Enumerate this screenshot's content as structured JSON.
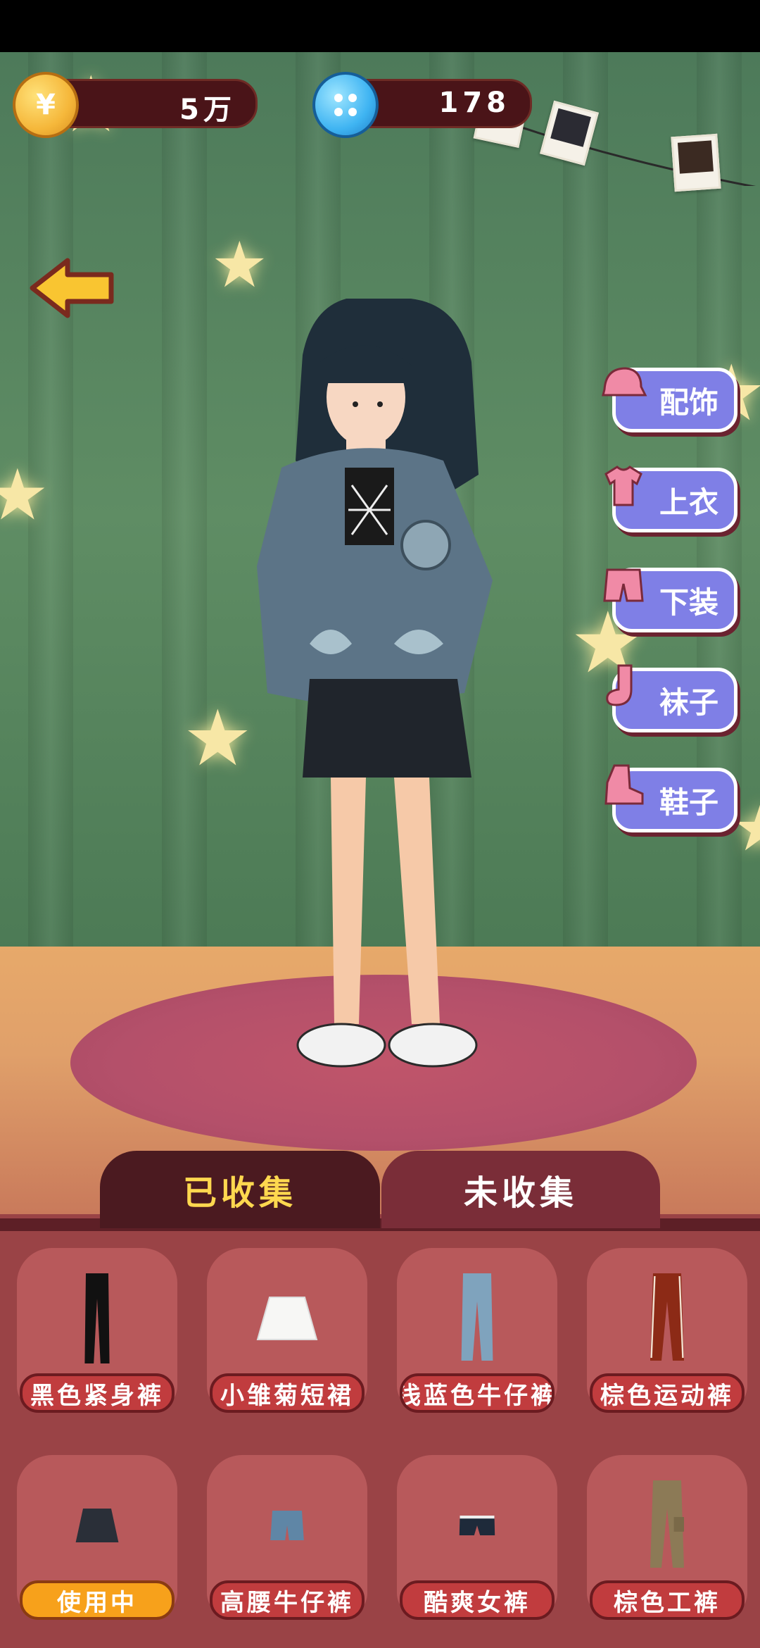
{
  "currency": {
    "coins": "5万",
    "buttons": "178"
  },
  "side_menu": [
    {
      "label": "配饰",
      "icon": "hat-icon"
    },
    {
      "label": "上衣",
      "icon": "shirt-icon"
    },
    {
      "label": "下装",
      "icon": "shorts-icon"
    },
    {
      "label": "袜子",
      "icon": "sock-icon"
    },
    {
      "label": "鞋子",
      "icon": "boot-icon"
    }
  ],
  "tabs": {
    "collected": "已收集",
    "uncollected": "未收集"
  },
  "items": [
    {
      "label": "黑色紧身裤",
      "status": ""
    },
    {
      "label": "小雏菊短裙",
      "status": ""
    },
    {
      "label": "浅蓝色牛仔裤",
      "status": ""
    },
    {
      "label": "棕色运动裤",
      "status": ""
    },
    {
      "label": "使用中",
      "status": "in-use"
    },
    {
      "label": "高腰牛仔裤",
      "status": ""
    },
    {
      "label": "酷爽女裤",
      "status": ""
    },
    {
      "label": "棕色工裤",
      "status": ""
    }
  ],
  "colors": {
    "curtain": "#5f8d64",
    "stage": "#e0a06a",
    "panel": "#9a4346",
    "active_tab_text": "#ffd84f",
    "side_button": "#7f7fe6",
    "in_use_label": "#f7a11b"
  }
}
